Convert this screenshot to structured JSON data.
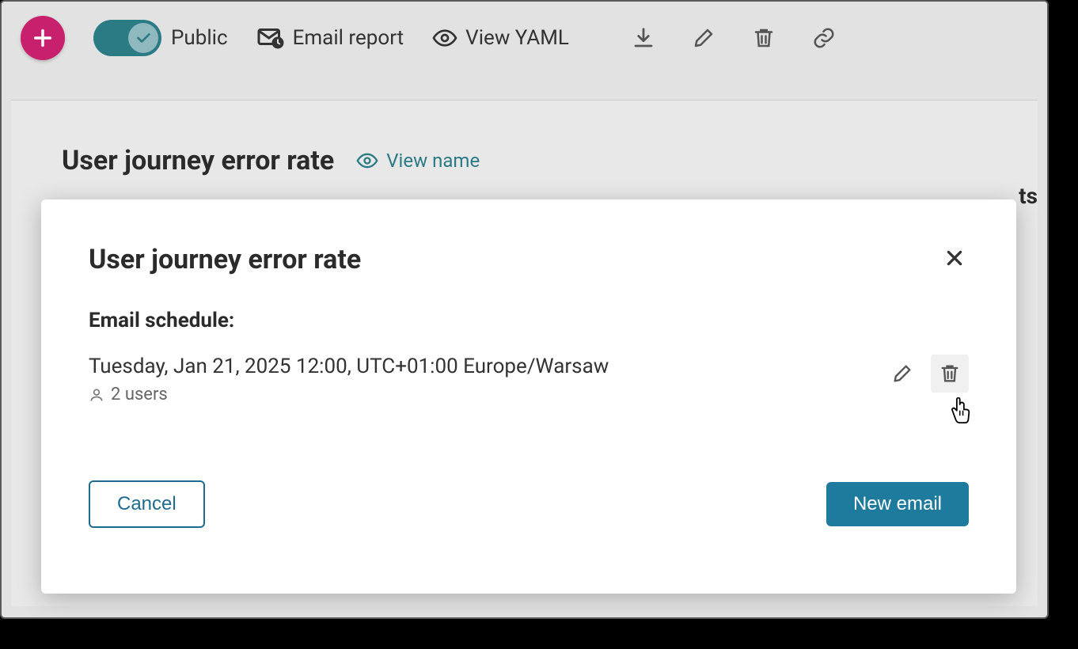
{
  "toolbar": {
    "public_label": "Public",
    "email_report_label": "Email report",
    "view_yaml_label": "View YAML"
  },
  "page": {
    "title": "User journey error rate",
    "view_name_label": "View name",
    "partial_side_text": "ts"
  },
  "modal": {
    "title": "User journey error rate",
    "section_label": "Email schedule:",
    "schedule": {
      "datetime": "Tuesday, Jan 21, 2025 12:00, UTC+01:00 Europe/Warsaw",
      "users_label": "2 users"
    },
    "cancel_label": "Cancel",
    "new_email_label": "New email"
  }
}
